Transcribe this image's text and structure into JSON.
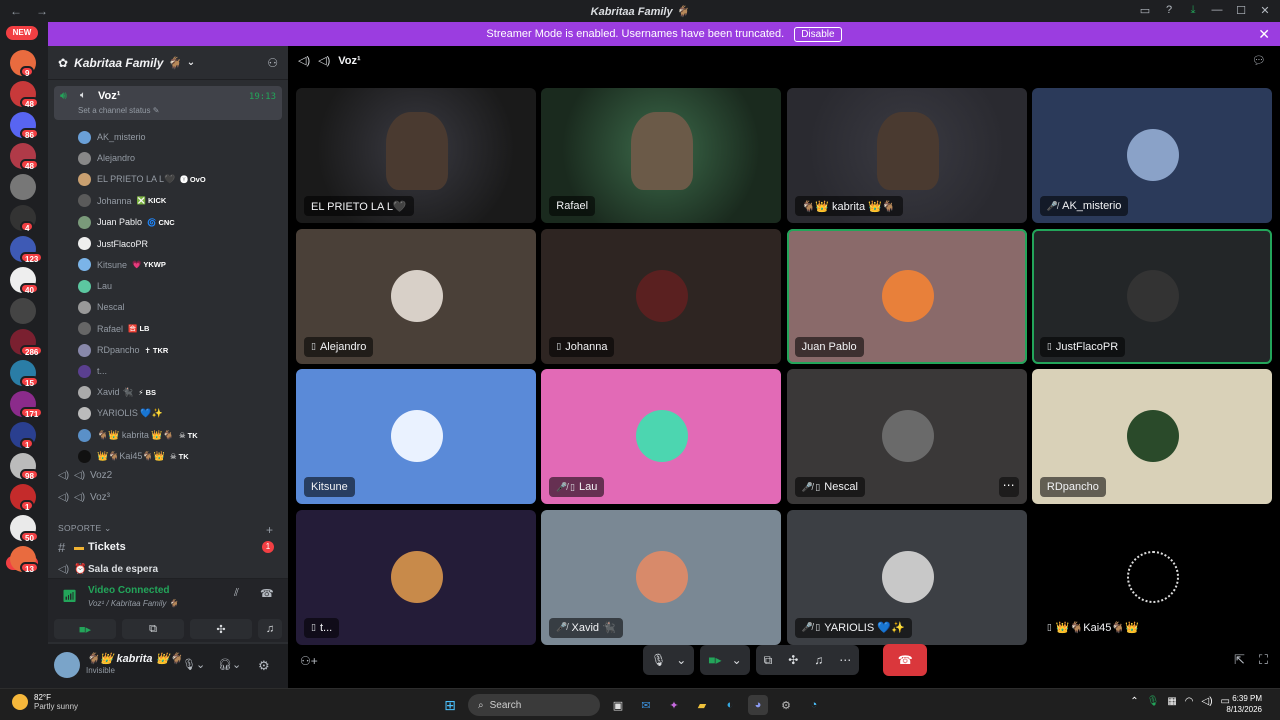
{
  "window": {
    "title": "Kabritaa Family 🐐"
  },
  "banner": {
    "text": "Streamer Mode is enabled. Usernames have been truncated.",
    "button": "Disable"
  },
  "guilds": {
    "new_top": "NEW",
    "new_bottom": "NEW",
    "badges": [
      "9",
      "48",
      "86",
      "48",
      "4",
      "123",
      "40",
      "286",
      "15",
      "171",
      "1",
      "98",
      "1",
      "50",
      "13"
    ]
  },
  "server": {
    "name": "Kabritaa Family 🐐"
  },
  "channel": {
    "name": "Voz¹",
    "status": "Set a channel status ✎",
    "timer": "19:13"
  },
  "voice_users": [
    {
      "name": "AK_misterio",
      "tag": "",
      "active": false
    },
    {
      "name": "Alejandro",
      "tag": "",
      "active": false
    },
    {
      "name": "EL PRIETO LA L🖤",
      "tag": "🅨 OvO",
      "active": false
    },
    {
      "name": "Johanna",
      "tag": "❎ KICK",
      "active": false
    },
    {
      "name": "Juan Pablo",
      "tag": "🌀 CNC",
      "active": true
    },
    {
      "name": "JustFlacoPR",
      "tag": "",
      "active": true
    },
    {
      "name": "Kitsune",
      "tag": "💗 YKWP",
      "active": false
    },
    {
      "name": "Lau",
      "tag": "",
      "active": false
    },
    {
      "name": "Nescal",
      "tag": "",
      "active": false
    },
    {
      "name": "Rafael",
      "tag": "🈴 LB",
      "active": false
    },
    {
      "name": "RDpancho",
      "tag": "✝ TKR",
      "active": false
    },
    {
      "name": "t...",
      "tag": "",
      "active": false
    },
    {
      "name": "Xavid 🐈‍⬛",
      "tag": "⚡ BS",
      "active": false
    },
    {
      "name": "YARIOLIS 💙✨",
      "tag": "",
      "active": false
    },
    {
      "name": "🐐👑 kabrita 👑🐐",
      "tag": "☠ TK",
      "active": false
    },
    {
      "name": "👑🐐Kai45🐐👑",
      "tag": "☠ TK",
      "active": false
    }
  ],
  "channels": {
    "voz2": "Voz2",
    "voz3": "Voz³",
    "category": "SOPORTE",
    "tickets": "Tickets",
    "tickets_badge": "1",
    "sala": "Sala de espera"
  },
  "voice_panel": {
    "status": "Video Connected",
    "sub": "Voz¹ / Kabritaa Family 🐐"
  },
  "user": {
    "name": "🐐👑 kabrita 👑🐐",
    "status": "Invisible"
  },
  "main": {
    "channel_name": "Voz¹"
  },
  "tiles": [
    {
      "name": "EL PRIETO LA L🖤",
      "icons": "",
      "video": true
    },
    {
      "name": "Rafael",
      "icons": "",
      "video": true
    },
    {
      "name": "🐐👑 kabrita 👑🐐",
      "icons": "",
      "video": true
    },
    {
      "name": "AK_misterio",
      "icons": "🎤̸",
      "video": false
    },
    {
      "name": "Alejandro",
      "icons": "▯",
      "video": false
    },
    {
      "name": "Johanna",
      "icons": "▯",
      "video": false
    },
    {
      "name": "Juan Pablo",
      "icons": "",
      "video": false
    },
    {
      "name": "JustFlacoPR",
      "icons": "▯",
      "video": false
    },
    {
      "name": "Kitsune",
      "icons": "",
      "video": false
    },
    {
      "name": "Lau",
      "icons": "🎤̸ ▯",
      "video": false
    },
    {
      "name": "Nescal",
      "icons": "🎤̸ ▯",
      "video": false
    },
    {
      "name": "RDpancho",
      "icons": "",
      "video": false
    },
    {
      "name": "t...",
      "icons": "▯",
      "video": false
    },
    {
      "name": "Xavid 🐈‍⬛",
      "icons": "🎤̸",
      "video": false
    },
    {
      "name": "YARIOLIS 💙✨",
      "icons": "🎤̸ ▯",
      "video": false
    },
    {
      "name": "👑🐐Kai45🐐👑",
      "icons": "▯",
      "video": false
    }
  ],
  "taskbar": {
    "weather_temp": "82°F",
    "weather_desc": "Partly sunny",
    "search": "Search",
    "time": "6:39 PM",
    "date": "8/13/2026"
  },
  "colors": {
    "accent": "#9b3de0",
    "speaking": "#23a55a",
    "danger": "#da373c"
  }
}
